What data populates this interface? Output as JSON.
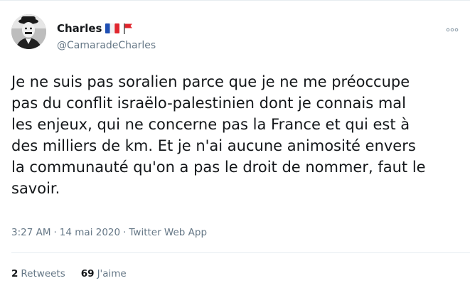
{
  "user": {
    "display_name": "Charles",
    "handle": "@CamaradeCharles",
    "flags": [
      "france-flag-icon",
      "red-flag-icon"
    ]
  },
  "tweet": {
    "text": "Je ne suis pas soralien parce que je ne me préoccupe\npas du conflit israëlo-palestinien dont je connais mal\nles enjeux, qui ne concerne pas la France et qui est à\ndes milliers de km. Et je n'ai aucune animosité envers\nla communauté qu'on a pas le droit de nommer, faut le\nsavoir.",
    "time": "3:27 AM",
    "separator1": "·",
    "date": "14 mai 2020",
    "separator2": "·",
    "source": "Twitter Web App"
  },
  "stats": {
    "retweets_count": "2",
    "retweets_label": "Retweets",
    "likes_count": "69",
    "likes_label": "J'aime"
  },
  "more_icon": "more-dots-icon",
  "colors": {
    "text": "#14171a",
    "muted": "#657786",
    "divider": "#e6ecf0"
  }
}
